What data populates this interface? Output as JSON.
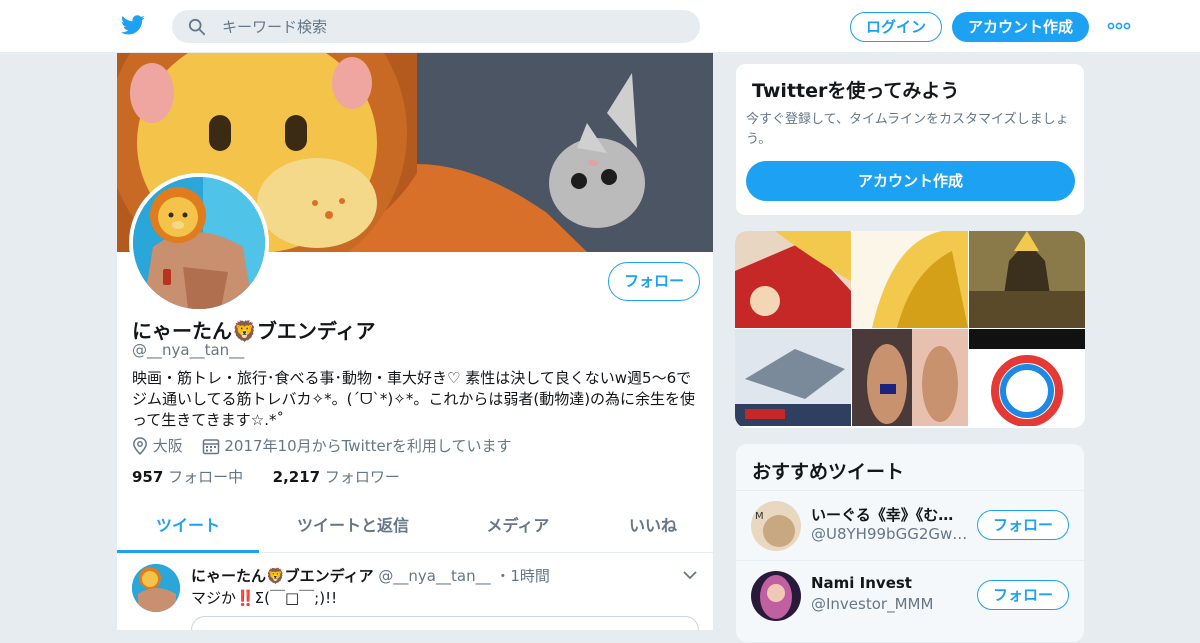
{
  "topbar": {
    "search_placeholder": "キーワード検索",
    "login_label": "ログイン",
    "signup_label": "アカウント作成",
    "logo_icon": "twitter-bird-icon",
    "more_icon": "more-dots-icon",
    "accent_color": "#1da1f2"
  },
  "profile": {
    "name": "にゃーたん🦁ブエンディア",
    "handle": "@__nya__tan__",
    "follow_label": "フォロー",
    "bio": "映画・筋トレ・旅行･食べる事･動物・車大好き♡ 素性は決して良くないw週5〜6でジム通いしてる筋トレバカ✧*。(ˊᗜˋ*)✧*。これからは弱者(動物達)の為に余生を使って生きてきます☆.*˚",
    "location": "大阪",
    "joined": "2017年10月からTwitterを利用しています",
    "following_count": "957",
    "following_label": "フォロー中",
    "followers_count": "2,217",
    "followers_label": "フォロワー"
  },
  "tabs": [
    {
      "label": "ツイート",
      "active": true
    },
    {
      "label": "ツイートと返信",
      "active": false
    },
    {
      "label": "メディア",
      "active": false
    },
    {
      "label": "いいね",
      "active": false
    }
  ],
  "tweet": {
    "name": "にゃーたん🦁ブエンディア",
    "handle": "@__nya__tan__",
    "separator": "・",
    "time": "1時間",
    "text": "マジか‼️Σ(￣□￣;)!!"
  },
  "sidebar": {
    "signup_box": {
      "title": "Twitterを使ってみよう",
      "subtitle": "今すぐ登録して、タイムラインをカスタマイズしましょう。",
      "button_label": "アカウント作成"
    },
    "recommended": {
      "title": "おすすめツイート",
      "items": [
        {
          "name": "いーぐる《幸》《む…",
          "handle": "@U8YH99bGG2GwC…",
          "follow_label": "フォロー"
        },
        {
          "name": "Nami Invest",
          "handle": "@Investor_MMM",
          "follow_label": "フォロー"
        }
      ]
    }
  }
}
